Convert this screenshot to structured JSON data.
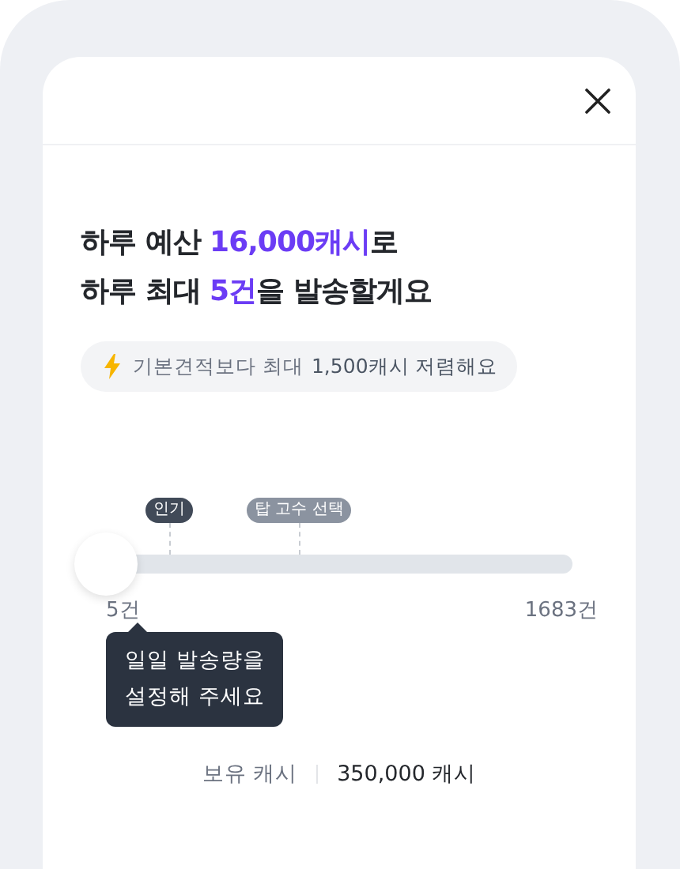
{
  "title_lines": [
    "하루 예산 **16,000캐시**로",
    "하루 최대 **5건**을 발송할게요"
  ],
  "savings_badge": {
    "prefix": "기본견적보다 최대",
    "amount": "1,500캐시 저렴해요"
  },
  "slider": {
    "level": 0,
    "min_label": "5건",
    "max_label": "1683건",
    "markers": [
      {
        "label": "인기",
        "kind": "dark"
      },
      {
        "label": "탑 고수 선택",
        "kind": "light"
      }
    ]
  },
  "tooltip": [
    "일일 발송량을",
    "설정해 주세요"
  ],
  "balance": {
    "label": "보유 캐시",
    "value": "350,000 캐시"
  }
}
